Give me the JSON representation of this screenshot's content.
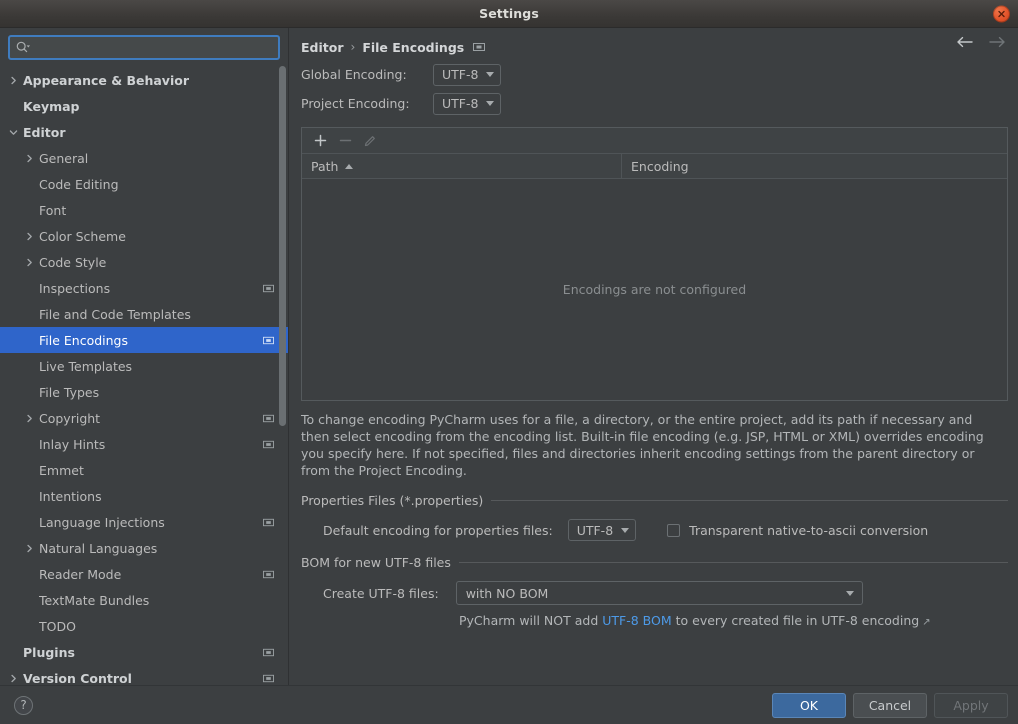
{
  "window": {
    "title": "Settings",
    "close_icon": "close-icon"
  },
  "search": {
    "value": "",
    "placeholder": "",
    "icon": "search-icon"
  },
  "sidebar": {
    "items": [
      {
        "label": "Appearance & Behavior",
        "depth": 0,
        "twisty": "right",
        "bold": true,
        "badge": false,
        "selected": false
      },
      {
        "label": "Keymap",
        "depth": 0,
        "twisty": "none",
        "bold": true,
        "badge": false,
        "selected": false
      },
      {
        "label": "Editor",
        "depth": 0,
        "twisty": "down",
        "bold": true,
        "badge": false,
        "selected": false
      },
      {
        "label": "General",
        "depth": 1,
        "twisty": "right",
        "bold": false,
        "badge": false,
        "selected": false
      },
      {
        "label": "Code Editing",
        "depth": 1,
        "twisty": "none",
        "bold": false,
        "badge": false,
        "selected": false
      },
      {
        "label": "Font",
        "depth": 1,
        "twisty": "none",
        "bold": false,
        "badge": false,
        "selected": false
      },
      {
        "label": "Color Scheme",
        "depth": 1,
        "twisty": "right",
        "bold": false,
        "badge": false,
        "selected": false
      },
      {
        "label": "Code Style",
        "depth": 1,
        "twisty": "right",
        "bold": false,
        "badge": false,
        "selected": false
      },
      {
        "label": "Inspections",
        "depth": 1,
        "twisty": "none",
        "bold": false,
        "badge": true,
        "selected": false
      },
      {
        "label": "File and Code Templates",
        "depth": 1,
        "twisty": "none",
        "bold": false,
        "badge": false,
        "selected": false
      },
      {
        "label": "File Encodings",
        "depth": 1,
        "twisty": "none",
        "bold": false,
        "badge": true,
        "selected": true
      },
      {
        "label": "Live Templates",
        "depth": 1,
        "twisty": "none",
        "bold": false,
        "badge": false,
        "selected": false
      },
      {
        "label": "File Types",
        "depth": 1,
        "twisty": "none",
        "bold": false,
        "badge": false,
        "selected": false
      },
      {
        "label": "Copyright",
        "depth": 1,
        "twisty": "right",
        "bold": false,
        "badge": true,
        "selected": false
      },
      {
        "label": "Inlay Hints",
        "depth": 1,
        "twisty": "none",
        "bold": false,
        "badge": true,
        "selected": false
      },
      {
        "label": "Emmet",
        "depth": 1,
        "twisty": "none",
        "bold": false,
        "badge": false,
        "selected": false
      },
      {
        "label": "Intentions",
        "depth": 1,
        "twisty": "none",
        "bold": false,
        "badge": false,
        "selected": false
      },
      {
        "label": "Language Injections",
        "depth": 1,
        "twisty": "none",
        "bold": false,
        "badge": true,
        "selected": false
      },
      {
        "label": "Natural Languages",
        "depth": 1,
        "twisty": "right",
        "bold": false,
        "badge": false,
        "selected": false
      },
      {
        "label": "Reader Mode",
        "depth": 1,
        "twisty": "none",
        "bold": false,
        "badge": true,
        "selected": false
      },
      {
        "label": "TextMate Bundles",
        "depth": 1,
        "twisty": "none",
        "bold": false,
        "badge": false,
        "selected": false
      },
      {
        "label": "TODO",
        "depth": 1,
        "twisty": "none",
        "bold": false,
        "badge": false,
        "selected": false
      },
      {
        "label": "Plugins",
        "depth": 0,
        "twisty": "none",
        "bold": true,
        "badge": true,
        "selected": false
      },
      {
        "label": "Version Control",
        "depth": 0,
        "twisty": "right",
        "bold": true,
        "badge": true,
        "selected": false
      }
    ]
  },
  "breadcrumb": {
    "parent": "Editor",
    "separator": "›",
    "current": "File Encodings",
    "badge_icon": "project-scope-icon"
  },
  "nav": {
    "back_icon": "arrow-left-icon",
    "forward_icon": "arrow-right-icon"
  },
  "encodings": {
    "global_label": "Global Encoding:",
    "global_value": "UTF-8",
    "project_label": "Project Encoding:",
    "project_value": "UTF-8"
  },
  "table": {
    "toolbar": {
      "add_icon": "plus-icon",
      "remove_icon": "minus-icon",
      "edit_icon": "pencil-icon"
    },
    "columns": [
      "Path",
      "Encoding"
    ],
    "sort_column": "Path",
    "sort_direction": "asc",
    "rows": [],
    "empty_text": "Encodings are not configured"
  },
  "help_text": "To change encoding PyCharm uses for a file, a directory, or the entire project, add its path if necessary and then select encoding from the encoding list. Built-in file encoding (e.g. JSP, HTML or XML) overrides encoding you specify here. If not specified, files and directories inherit encoding settings from the parent directory or from the Project Encoding.",
  "properties_section": {
    "title": "Properties Files (*.properties)",
    "encoding_label": "Default encoding for properties files:",
    "encoding_value": "UTF-8",
    "checkbox_label": "Transparent native-to-ascii conversion",
    "checkbox_checked": false
  },
  "bom_section": {
    "title": "BOM for new UTF-8 files",
    "create_label": "Create UTF-8 files:",
    "create_value": "with NO BOM",
    "hint_prefix": "PyCharm will NOT add ",
    "hint_link": "UTF-8 BOM",
    "hint_suffix": " to every created file in UTF-8 encoding",
    "external_arrow": "↗"
  },
  "footer": {
    "help_icon": "question-mark-icon",
    "help_glyph": "?",
    "ok_label": "OK",
    "cancel_label": "Cancel",
    "apply_label": "Apply",
    "apply_enabled": false
  },
  "colors": {
    "accent": "#2f65ca",
    "primary_button": "#3c699e",
    "link": "#4d9ae8",
    "background": "#3c3f41",
    "close_button": "#e2532a"
  }
}
